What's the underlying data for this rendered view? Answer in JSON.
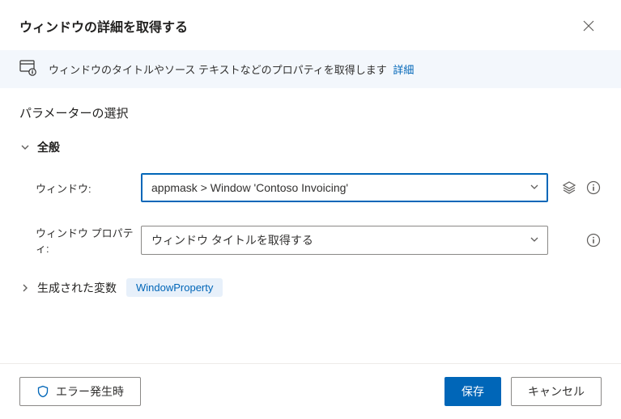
{
  "header": {
    "title": "ウィンドウの詳細を取得する"
  },
  "banner": {
    "text": "ウィンドウのタイトルやソース テキストなどのプロパティを取得します",
    "link": "詳細"
  },
  "body": {
    "sectionTitle": "パラメーターの選択",
    "generalLabel": "全般",
    "fields": {
      "window": {
        "label": "ウィンドウ:",
        "value": "appmask > Window 'Contoso Invoicing'"
      },
      "property": {
        "label": "ウィンドウ プロパティ:",
        "value": "ウィンドウ タイトルを取得する"
      }
    },
    "generatedVars": {
      "label": "生成された変数",
      "value": "WindowProperty"
    }
  },
  "footer": {
    "onError": "エラー発生時",
    "save": "保存",
    "cancel": "キャンセル"
  }
}
